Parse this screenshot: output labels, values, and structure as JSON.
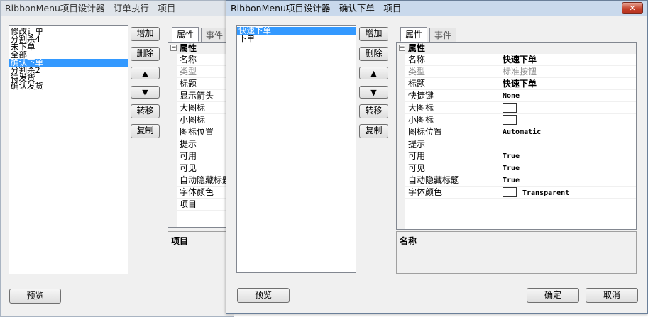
{
  "back_window": {
    "title": "RibbonMenu项目设计器 - 订单执行 - 项目",
    "items": [
      {
        "label": "修改订单",
        "selected": false
      },
      {
        "label": "分割杀4",
        "selected": false
      },
      {
        "label": "未下单",
        "selected": false
      },
      {
        "label": "全部",
        "selected": false
      },
      {
        "label": "确认下单",
        "selected": true
      },
      {
        "label": "分割杀2",
        "selected": false
      },
      {
        "label": "待发货",
        "selected": false
      },
      {
        "label": "确认发货",
        "selected": false
      }
    ],
    "buttons": {
      "add": "增加",
      "delete": "删除",
      "up": "▲",
      "down": "▼",
      "move": "转移",
      "copy": "复制",
      "preview": "预览"
    },
    "tabs": {
      "properties": "属性",
      "events": "事件"
    },
    "grid_category": "属性",
    "properties": [
      "名称",
      "类型",
      "标题",
      "显示箭头",
      "大图标",
      "小图标",
      "图标位置",
      "提示",
      "可用",
      "可见",
      "自动隐藏标题",
      "字体颜色",
      "项目"
    ],
    "description_title": "项目"
  },
  "front_window": {
    "title": "RibbonMenu项目设计器 - 确认下单 - 项目",
    "close_label": "✕",
    "items": [
      {
        "label": "快速下单",
        "selected": true
      },
      {
        "label": "下单",
        "selected": false
      }
    ],
    "buttons": {
      "add": "增加",
      "delete": "删除",
      "up": "▲",
      "down": "▼",
      "move": "转移",
      "copy": "复制",
      "preview": "预览",
      "ok": "确定",
      "cancel": "取消"
    },
    "tabs": {
      "properties": "属性",
      "events": "事件"
    },
    "grid_category": "属性",
    "properties": [
      {
        "name": "名称",
        "value": "快速下单"
      },
      {
        "name": "类型",
        "value": "标准按钮"
      },
      {
        "name": "标题",
        "value": "快速下单"
      },
      {
        "name": "快捷键",
        "value": "None"
      },
      {
        "name": "大图标",
        "value": ""
      },
      {
        "name": "小图标",
        "value": ""
      },
      {
        "name": "图标位置",
        "value": "Automatic"
      },
      {
        "name": "提示",
        "value": ""
      },
      {
        "name": "可用",
        "value": "True"
      },
      {
        "name": "可见",
        "value": "True"
      },
      {
        "name": "自动隐藏标题",
        "value": "True"
      },
      {
        "name": "字体颜色",
        "value": "Transparent"
      }
    ],
    "description_title": "名称"
  }
}
